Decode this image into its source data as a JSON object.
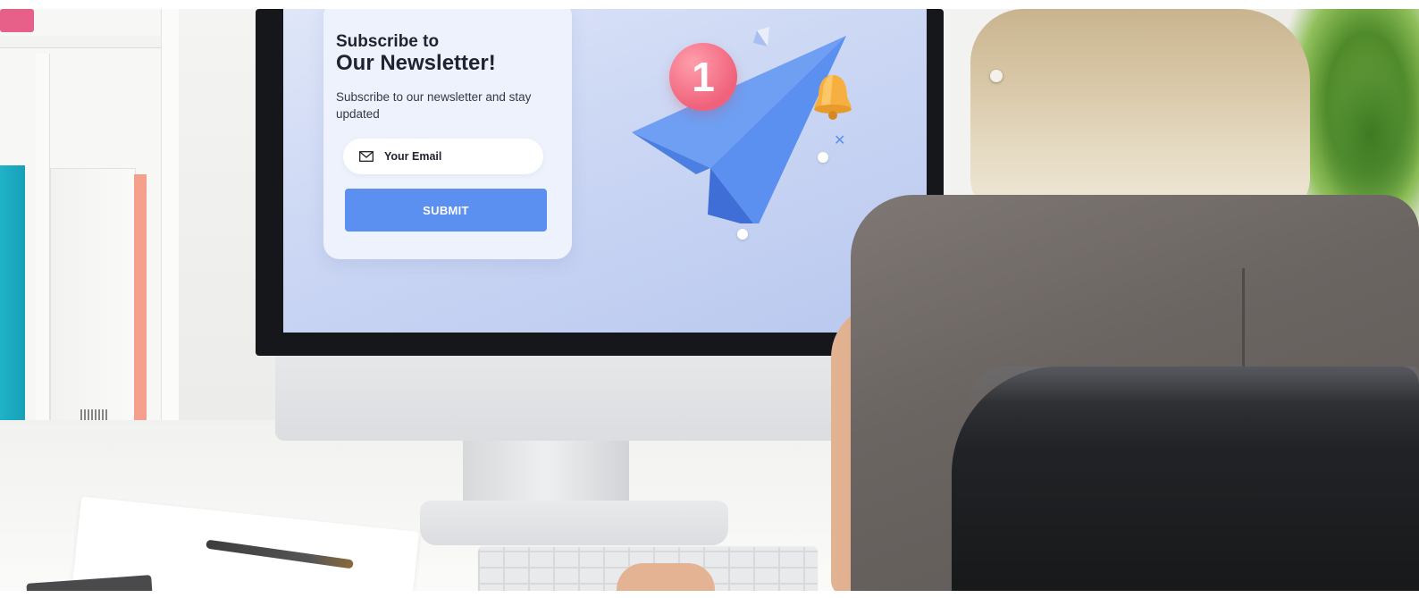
{
  "newsletter": {
    "subtitle": "Subscribe to",
    "title": "Our Newsletter!",
    "description": "Subscribe to our newsletter and stay updated",
    "email_placeholder": "Your Email",
    "submit_label": "SUBMIT"
  },
  "illustration": {
    "badge_count": "1",
    "accent_color": "#5b8ff0",
    "badge_color": "#f0617b",
    "bell_color": "#f7b040"
  },
  "icons": [
    "envelope-icon",
    "paper-plane-icon",
    "bell-icon"
  ]
}
